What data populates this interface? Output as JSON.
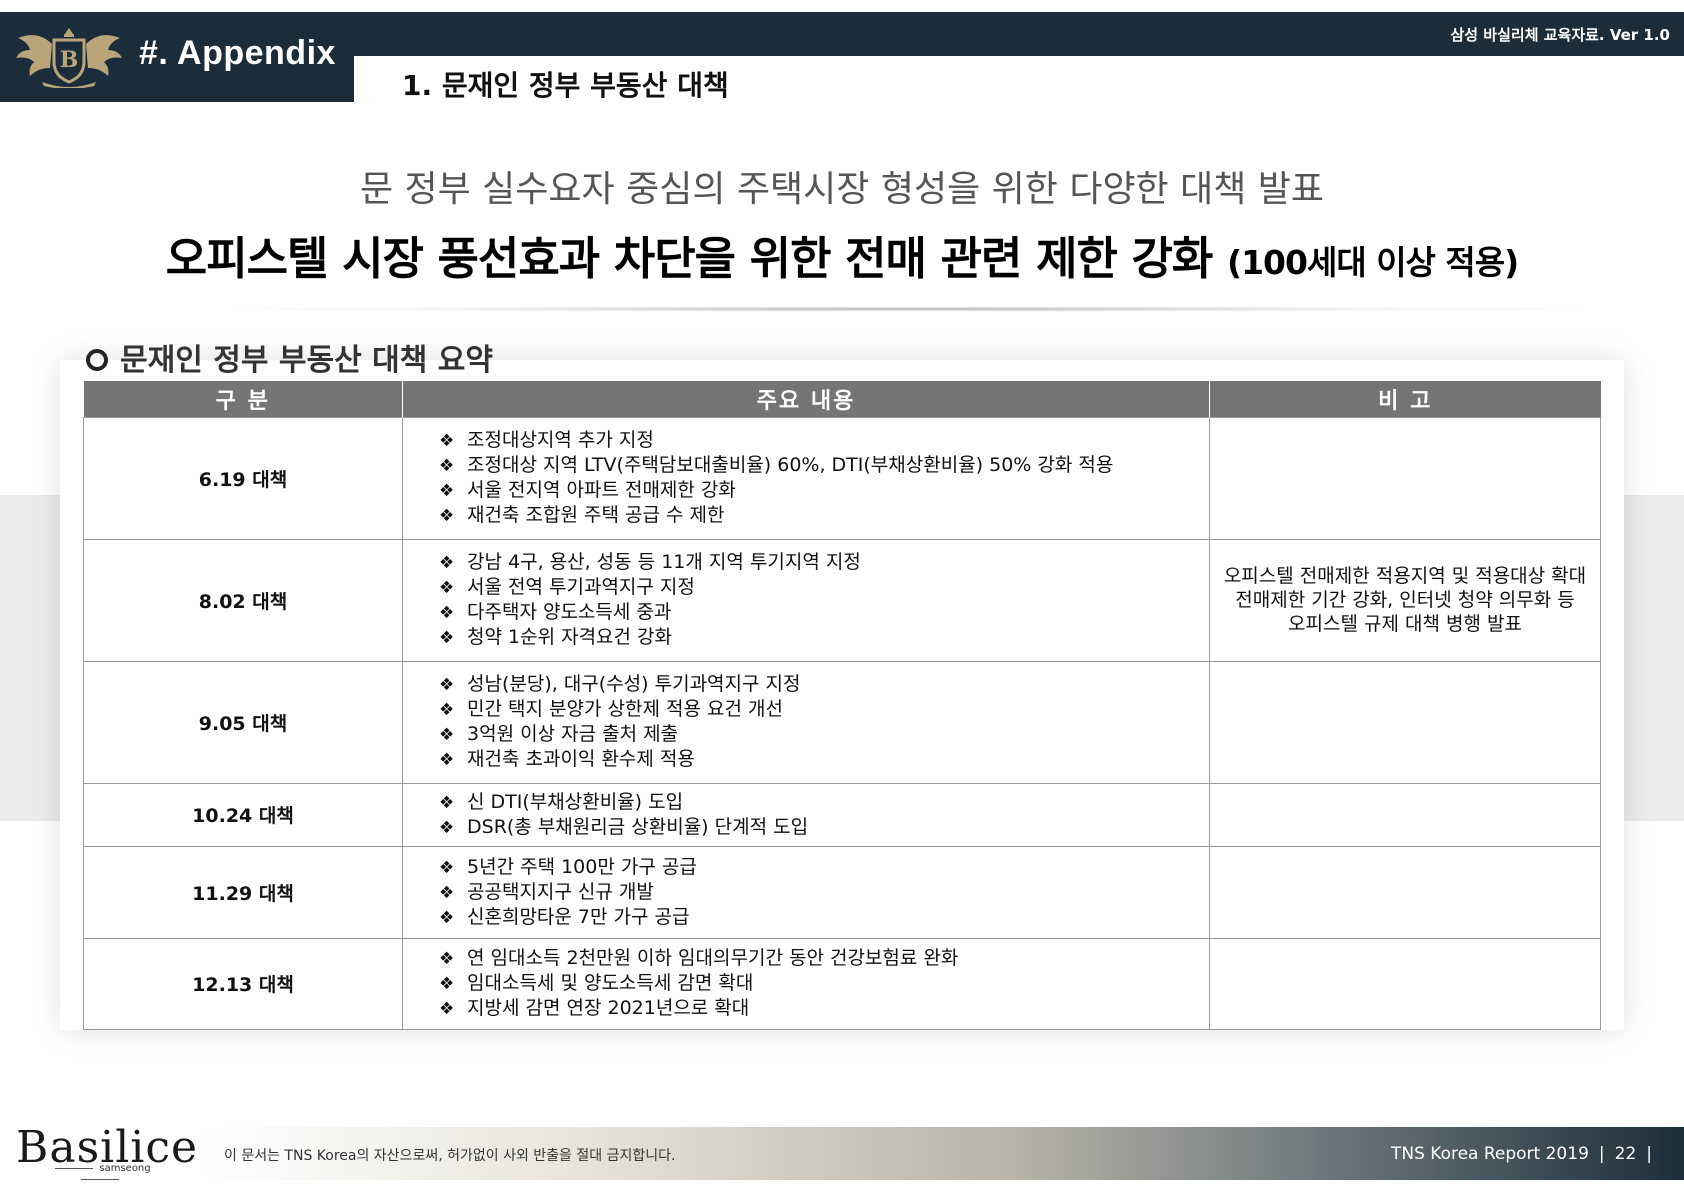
{
  "header": {
    "appendix": "#. Appendix",
    "section_title": "1. 문재인 정부 부동산 대책",
    "version": "삼성 바실리체 교육자료. Ver 1.0"
  },
  "headline": {
    "subtitle": "문 정부 실수요자 중심의 주택시장 형성을 위한 다양한 대책 발표",
    "main": "오피스텔 시장 풍선효과 차단을 위한 전매 관련 제한 강화",
    "main_suffix": "(100세대 이상 적용)"
  },
  "summary_title": "문재인 정부 부동산 대책 요약",
  "table": {
    "headers": [
      "구 분",
      "주요 내용",
      "비 고"
    ],
    "bullet": "❖",
    "rows": [
      {
        "category": "6.19 대책",
        "items": [
          "조정대상지역 추가 지정",
          "조정대상 지역 LTV(주택담보대출비율) 60%, DTI(부채상환비율) 50% 강화 적용",
          "서울 전지역 아파트 전매제한 강화",
          "재건축 조합원 주택 공급 수 제한"
        ]
      },
      {
        "category": "8.02 대책",
        "items": [
          "강남 4구, 용산, 성동 등 11개 지역 투기지역 지정",
          "서울 전역 투기과역지구 지정",
          "다주택자 양도소득세 중과",
          "청약 1순위 자격요건 강화"
        ]
      },
      {
        "category": "9.05 대책",
        "items": [
          "성남(분당), 대구(수성) 투기과역지구 지정",
          "민간 택지 분양가 상한제 적용 요건 개선",
          "3억원 이상 자금 출처 제출",
          "재건축 초과이익 환수제 적용"
        ]
      },
      {
        "category": "10.24 대책",
        "items": [
          "신 DTI(부채상환비율) 도입",
          "DSR(총 부채원리금 상환비율) 단계적 도입"
        ]
      },
      {
        "category": "11.29 대책",
        "items": [
          "5년간 주택 100만 가구 공급",
          "공공택지지구 신규 개발",
          "신혼희망타운 7만 가구 공급"
        ]
      },
      {
        "category": "12.13 대책",
        "items": [
          "연 임대소득 2천만원 이하 임대의무기간 동안 건강보험료 완화",
          "임대소득세 및 양도소득세 감면 확대",
          "지방세 감면 연장 2021년으로 확대"
        ]
      }
    ],
    "note_lines": [
      "오피스텔 전매제한 적용지역 및 적용대상 확대",
      "전매제한 기간 강화, 인터넷 청약 의무화 등",
      "오피스텔 규제 대책 병행 발표"
    ]
  },
  "footer": {
    "brand": "Basilice",
    "brand_sub": "samseong",
    "disclaimer": "이 문서는 TNS Korea의 자산으로써, 허가없이 사외 반출을 절대 금지합니다.",
    "report": "TNS Korea Report 2019",
    "page_number": "22"
  },
  "colors": {
    "navy": "#1b2d3a",
    "table_header": "#757575"
  }
}
